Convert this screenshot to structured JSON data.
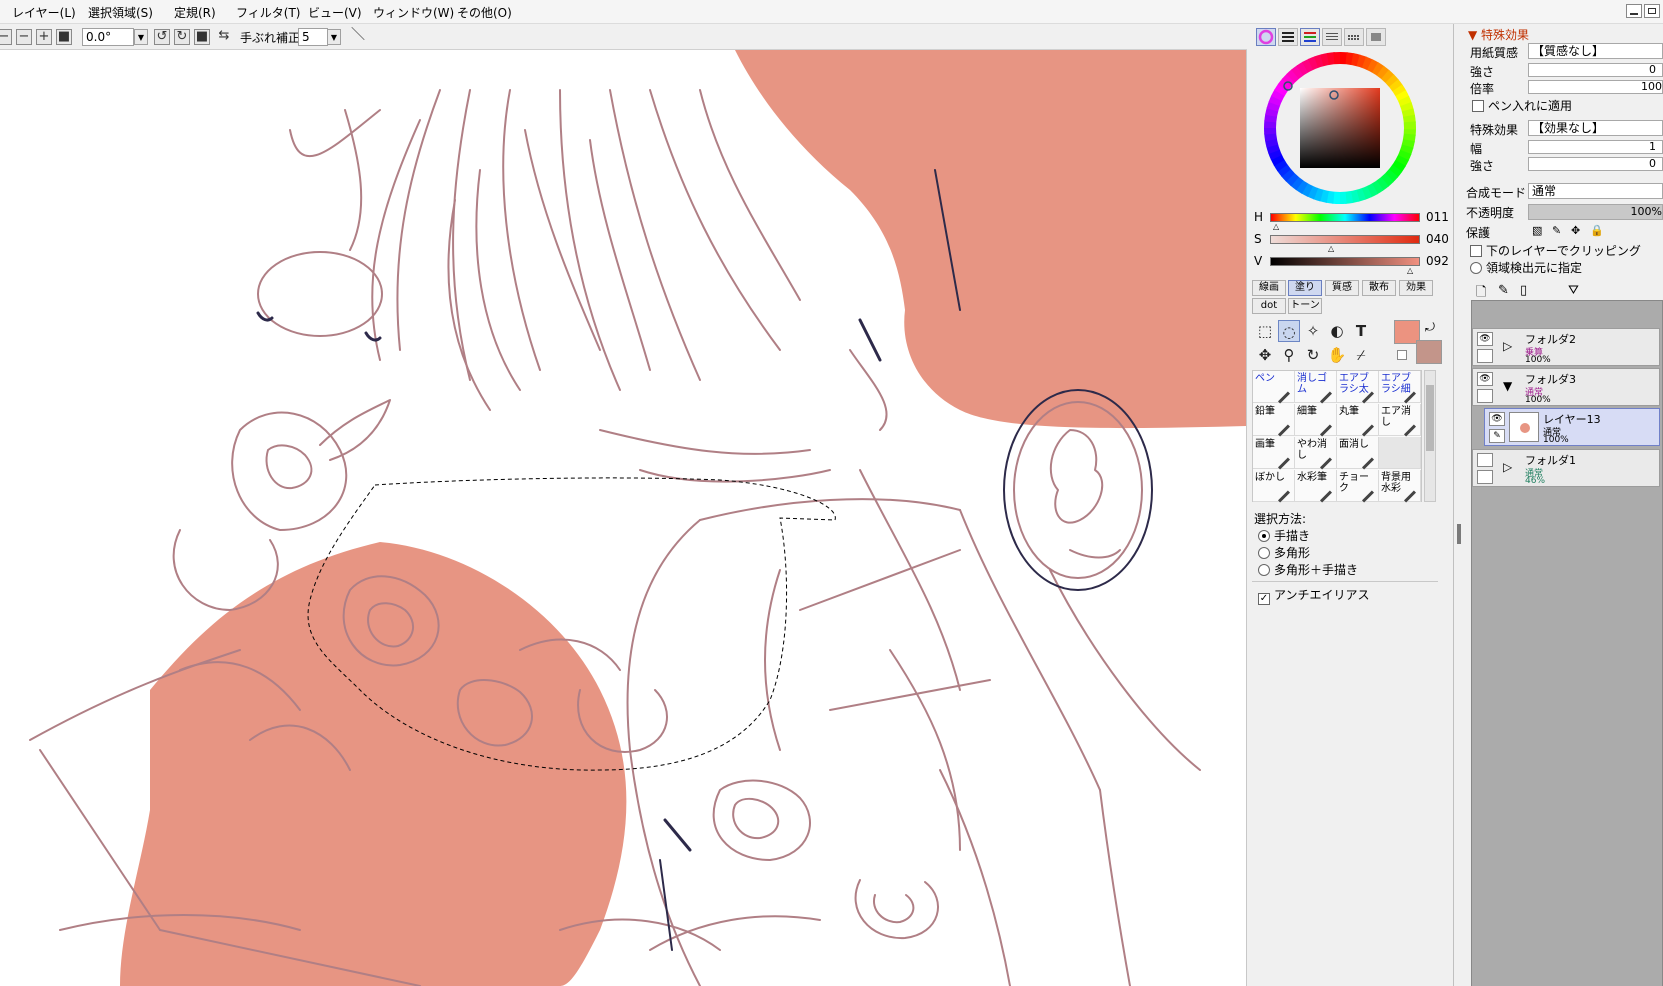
{
  "menubar": {
    "items": [
      "レイヤー(L)",
      "選択領域(S)",
      "定規(R)",
      "フィルタ(T)",
      "ビュー(V)",
      "ウィンドウ(W)",
      "その他(O)"
    ]
  },
  "toolopts": {
    "angle_value": "0.0°",
    "stabilizer_label": "手ぶれ補正",
    "stabilizer_value": "5"
  },
  "colors": {
    "fill": "#e79583",
    "fill_dark": "#dd7a66",
    "line": "#b07f85",
    "line_dark": "#2d2a4a",
    "primary_swatch": "#ec9380",
    "secondary_swatch": "#c3958a"
  },
  "hsv": {
    "h_label": "H",
    "h_value": "011",
    "s_label": "S",
    "s_value": "040",
    "v_label": "V",
    "v_value": "092"
  },
  "brush_tabs_row1": [
    "線画",
    "塗り",
    "質感",
    "散布",
    "効果"
  ],
  "brush_tabs_row2": [
    "dot",
    "トーン"
  ],
  "brushes": [
    [
      "ペン",
      "消しゴム",
      "エアブラシ太",
      "エアブラシ細"
    ],
    [
      "鉛筆",
      "細筆",
      "丸筆",
      "エア消し"
    ],
    [
      "画筆",
      "やわ消し",
      "面消し",
      ""
    ],
    [
      "ぼかし",
      "水彩筆",
      "チョーク",
      "背景用水彩"
    ]
  ],
  "selection": {
    "title": "選択方法:",
    "options": [
      "手描き",
      "多角形",
      "多角形＋手描き"
    ],
    "antialias": "アンチエイリアス"
  },
  "effects": {
    "header": "特殊効果",
    "paper_label": "用紙質感",
    "paper_value": "【質感なし】",
    "strength_label": "強さ",
    "strength_value": "0",
    "scale_label": "倍率",
    "scale_value": "100",
    "pen_label": "ペン入れに適用",
    "effect_label": "特殊効果",
    "effect_value": "【効果なし】",
    "width_label": "幅",
    "width_value": "1",
    "strength2_label": "強さ",
    "strength2_value": "0"
  },
  "blend": {
    "mode_label": "合成モード",
    "mode_value": "通常",
    "opacity_label": "不透明度",
    "opacity_value": "100%",
    "protect_label": "保護",
    "clip_label": "下のレイヤーでクリッピング",
    "detect_label": "領域検出元に指定"
  },
  "layers": [
    {
      "name": "フォルダ2",
      "mode": "乗算",
      "opacity": "100%"
    },
    {
      "name": "フォルダ3",
      "mode": "通常",
      "opacity": "100%"
    },
    {
      "name": "レイヤー13",
      "mode": "通常",
      "opacity": "100%"
    },
    {
      "name": "フォルダ1",
      "mode": "通常",
      "opacity": "46%"
    }
  ]
}
